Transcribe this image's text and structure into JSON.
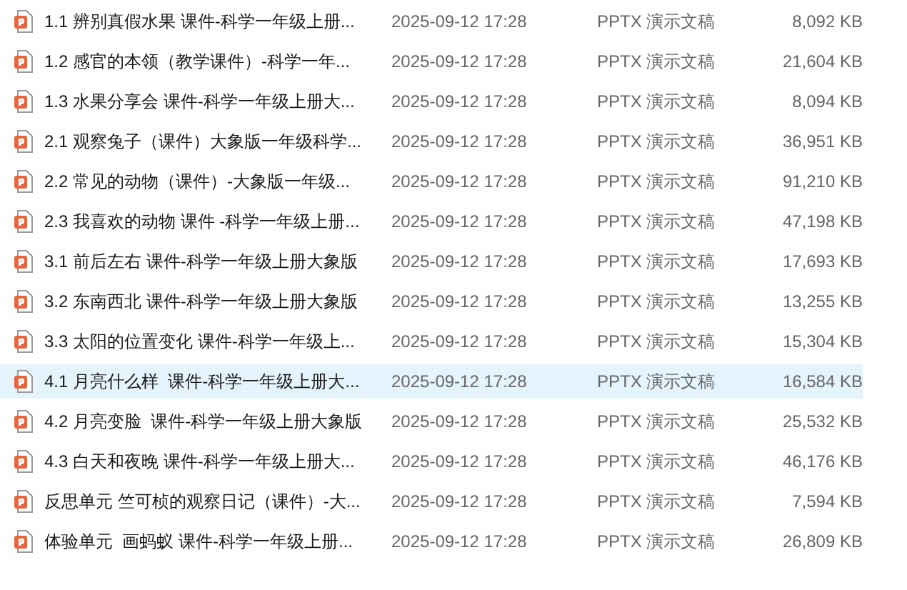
{
  "files": [
    {
      "name": "1.1 辨别真假水果 课件-科学一年级上册...",
      "modified": "2025-09-12 17:28",
      "type": "PPTX 演示文稿",
      "size": "8,092 KB",
      "selected": false
    },
    {
      "name": "1.2 感官的本领（教学课件）-科学一年...",
      "modified": "2025-09-12 17:28",
      "type": "PPTX 演示文稿",
      "size": "21,604 KB",
      "selected": false
    },
    {
      "name": "1.3 水果分享会 课件-科学一年级上册大...",
      "modified": "2025-09-12 17:28",
      "type": "PPTX 演示文稿",
      "size": "8,094 KB",
      "selected": false
    },
    {
      "name": "2.1 观察兔子（课件）大象版一年级科学...",
      "modified": "2025-09-12 17:28",
      "type": "PPTX 演示文稿",
      "size": "36,951 KB",
      "selected": false
    },
    {
      "name": "2.2 常见的动物（课件）-大象版一年级...",
      "modified": "2025-09-12 17:28",
      "type": "PPTX 演示文稿",
      "size": "91,210 KB",
      "selected": false
    },
    {
      "name": "2.3 我喜欢的动物 课件 -科学一年级上册...",
      "modified": "2025-09-12 17:28",
      "type": "PPTX 演示文稿",
      "size": "47,198 KB",
      "selected": false
    },
    {
      "name": "3.1 前后左右 课件-科学一年级上册大象版",
      "modified": "2025-09-12 17:28",
      "type": "PPTX 演示文稿",
      "size": "17,693 KB",
      "selected": false
    },
    {
      "name": "3.2 东南西北 课件-科学一年级上册大象版",
      "modified": "2025-09-12 17:28",
      "type": "PPTX 演示文稿",
      "size": "13,255 KB",
      "selected": false
    },
    {
      "name": "3.3 太阳的位置变化 课件-科学一年级上...",
      "modified": "2025-09-12 17:28",
      "type": "PPTX 演示文稿",
      "size": "15,304 KB",
      "selected": false
    },
    {
      "name": "4.1 月亮什么样  课件-科学一年级上册大...",
      "modified": "2025-09-12 17:28",
      "type": "PPTX 演示文稿",
      "size": "16,584 KB",
      "selected": true
    },
    {
      "name": "4.2 月亮变脸  课件-科学一年级上册大象版",
      "modified": "2025-09-12 17:28",
      "type": "PPTX 演示文稿",
      "size": "25,532 KB",
      "selected": false
    },
    {
      "name": "4.3 白天和夜晚 课件-科学一年级上册大...",
      "modified": "2025-09-12 17:28",
      "type": "PPTX 演示文稿",
      "size": "46,176 KB",
      "selected": false
    },
    {
      "name": "反思单元 竺可桢的观察日记（课件）-大...",
      "modified": "2025-09-12 17:28",
      "type": "PPTX 演示文稿",
      "size": "7,594 KB",
      "selected": false
    },
    {
      "name": "体验单元  画蚂蚁 课件-科学一年级上册...",
      "modified": "2025-09-12 17:28",
      "type": "PPTX 演示文稿",
      "size": "26,809 KB",
      "selected": false
    }
  ]
}
